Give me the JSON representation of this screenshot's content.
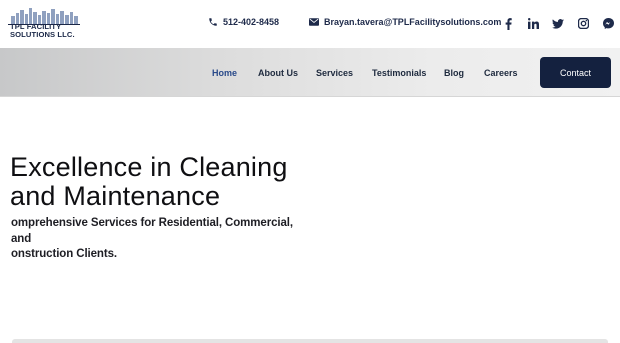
{
  "brand": {
    "logo_line1": "TPL FACILITY",
    "logo_line2": "SOLUTIONS LLC.",
    "logo_color": "#1a2747"
  },
  "topbar": {
    "phone": "512-402-8458",
    "email": "Brayan.tavera@TPLFacilitysolutions.com",
    "socials": [
      "facebook-icon",
      "linkedin-icon",
      "twitter-icon",
      "instagram-icon",
      "messenger-icon"
    ]
  },
  "nav": {
    "items": [
      {
        "label": "Home",
        "active": true
      },
      {
        "label": "About Us",
        "active": false
      },
      {
        "label": "Services",
        "active": false
      },
      {
        "label": "Testimonials",
        "active": false
      },
      {
        "label": "Blog",
        "active": false
      },
      {
        "label": "Careers",
        "active": false
      }
    ],
    "contact_label": "Contact",
    "contact_color": "#14213f"
  },
  "hero": {
    "title_line1": "Excellence in Cleaning",
    "title_line2": "and Maintenance",
    "subtitle_line1": "omprehensive Services for Residential, Commercial, and",
    "subtitle_line2": "onstruction Clients."
  }
}
